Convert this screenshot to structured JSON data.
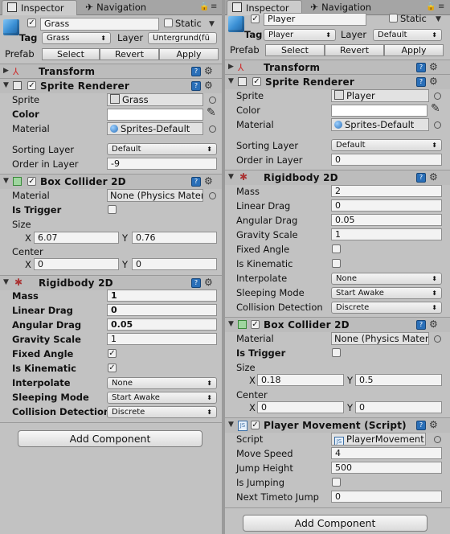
{
  "left": {
    "tabs": {
      "inspector": "Inspector",
      "navigation": "Navigation"
    },
    "object": {
      "name": "Grass",
      "static_label": "Static",
      "tag_label": "Tag",
      "tag_value": "Grass",
      "layer_label": "Layer",
      "layer_value": "Untergrund(fü",
      "prefab_label": "Prefab",
      "select": "Select",
      "revert": "Revert",
      "apply": "Apply"
    },
    "transform": {
      "title": "Transform"
    },
    "sprite_renderer": {
      "title": "Sprite Renderer",
      "sprite_label": "Sprite",
      "sprite_value": "Grass",
      "color_label": "Color",
      "material_label": "Material",
      "material_value": "Sprites-Default",
      "sorting_layer_label": "Sorting Layer",
      "sorting_layer_value": "Default",
      "order_label": "Order in Layer",
      "order_value": "-9"
    },
    "box_collider": {
      "title": "Box Collider 2D",
      "material_label": "Material",
      "material_value": "None (Physics Mater",
      "trigger_label": "Is Trigger",
      "size_label": "Size",
      "size_x": "6.07",
      "size_y": "0.76",
      "center_label": "Center",
      "center_x": "0",
      "center_y": "0",
      "x_label": "X",
      "y_label": "Y"
    },
    "rigidbody": {
      "title": "Rigidbody 2D",
      "mass_label": "Mass",
      "mass_value": "1",
      "linear_drag_label": "Linear Drag",
      "linear_drag_value": "0",
      "angular_drag_label": "Angular Drag",
      "angular_drag_value": "0.05",
      "gravity_label": "Gravity Scale",
      "gravity_value": "1",
      "fixed_angle_label": "Fixed Angle",
      "fixed_angle_checked": true,
      "kinematic_label": "Is Kinematic",
      "kinematic_checked": true,
      "interpolate_label": "Interpolate",
      "interpolate_value": "None",
      "sleeping_label": "Sleeping Mode",
      "sleeping_value": "Start Awake",
      "collision_label": "Collision Detection",
      "collision_value": "Discrete"
    },
    "add_component": "Add Component"
  },
  "right": {
    "tabs": {
      "inspector": "Inspector",
      "navigation": "Navigation"
    },
    "object": {
      "name": "Player",
      "static_label": "Static",
      "tag_label": "Tag",
      "tag_value": "Player",
      "layer_label": "Layer",
      "layer_value": "Default",
      "prefab_label": "Prefab",
      "select": "Select",
      "revert": "Revert",
      "apply": "Apply"
    },
    "transform": {
      "title": "Transform"
    },
    "sprite_renderer": {
      "title": "Sprite Renderer",
      "sprite_label": "Sprite",
      "sprite_value": "Player",
      "color_label": "Color",
      "material_label": "Material",
      "material_value": "Sprites-Default",
      "sorting_layer_label": "Sorting Layer",
      "sorting_layer_value": "Default",
      "order_label": "Order in Layer",
      "order_value": "0"
    },
    "rigidbody": {
      "title": "Rigidbody 2D",
      "mass_label": "Mass",
      "mass_value": "2",
      "linear_drag_label": "Linear Drag",
      "linear_drag_value": "0",
      "angular_drag_label": "Angular Drag",
      "angular_drag_value": "0.05",
      "gravity_label": "Gravity Scale",
      "gravity_value": "1",
      "fixed_angle_label": "Fixed Angle",
      "fixed_angle_checked": false,
      "kinematic_label": "Is Kinematic",
      "kinematic_checked": false,
      "interpolate_label": "Interpolate",
      "interpolate_value": "None",
      "sleeping_label": "Sleeping Mode",
      "sleeping_value": "Start Awake",
      "collision_label": "Collision Detection",
      "collision_value": "Discrete"
    },
    "box_collider": {
      "title": "Box Collider 2D",
      "material_label": "Material",
      "material_value": "None (Physics Mater",
      "trigger_label": "Is Trigger",
      "size_label": "Size",
      "size_x": "0.18",
      "size_y": "0.5",
      "center_label": "Center",
      "center_x": "0",
      "center_y": "0",
      "x_label": "X",
      "y_label": "Y"
    },
    "player_movement": {
      "title": "Player Movement (Script)",
      "script_label": "Script",
      "script_value": "PlayerMovement",
      "move_speed_label": "Move Speed",
      "move_speed_value": "4",
      "jump_height_label": "Jump Height",
      "jump_height_value": "500",
      "is_jumping_label": "Is Jumping",
      "next_jump_label": "Next Timeto Jump",
      "next_jump_value": "0"
    },
    "add_component": "Add Component"
  },
  "icons": {
    "inspector": "inspector-icon",
    "navigation": "navigation-icon",
    "gear": "gear-icon",
    "book": "help-book-icon",
    "menu": "menu-icon",
    "lock": "lock-icon",
    "object_picker": "object-picker-icon",
    "eyedropper": "eyedropper-icon"
  }
}
